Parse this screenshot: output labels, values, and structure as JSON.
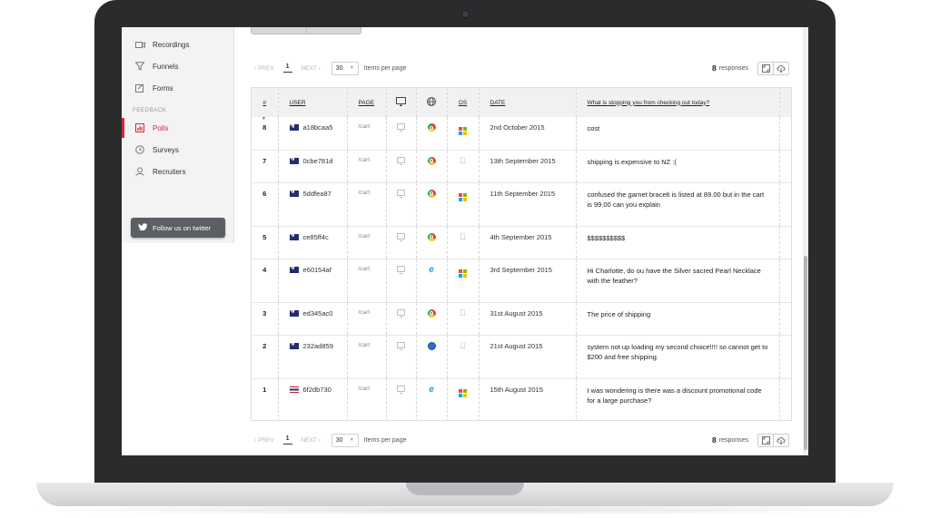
{
  "sidebar": {
    "items": [
      {
        "label": "Recordings",
        "icon": "video-camera-icon",
        "active": false
      },
      {
        "label": "Funnels",
        "icon": "funnel-icon",
        "active": false
      },
      {
        "label": "Forms",
        "icon": "form-icon",
        "active": false
      }
    ],
    "section_heading": "FEEDBACK",
    "feedback_items": [
      {
        "label": "Polls",
        "icon": "bar-chart-icon",
        "active": true
      },
      {
        "label": "Surveys",
        "icon": "clock-icon",
        "active": false
      },
      {
        "label": "Recruiters",
        "icon": "user-icon",
        "active": false
      }
    ],
    "twitter_button": "Follow us on twitter",
    "accent_color": "#d7263d"
  },
  "pager": {
    "prev": "‹ PREV",
    "page": "1",
    "next": "NEXT ›",
    "per_page": "30",
    "per_page_label": "Items per page"
  },
  "responses": {
    "count": "8",
    "label": "responses"
  },
  "table": {
    "headers": {
      "num": "#",
      "user": "USER",
      "page": "PAGE",
      "os": "OS",
      "date": "DATE",
      "question": "What is stopping you from checking out today?"
    },
    "rows": [
      {
        "num": "8",
        "flag": "australia",
        "user": "a18bcaa5",
        "page": "/cart",
        "device": "desktop-icon",
        "browser": "chrome",
        "os": "windows",
        "date": "2nd October 2015",
        "answer": "cost"
      },
      {
        "num": "7",
        "flag": "australia",
        "user": "0cbe781d",
        "page": "/cart",
        "device": "desktop-icon",
        "browser": "chrome",
        "os": "apple",
        "date": "13th September 2015",
        "answer": "shipping is expensive to NZ :("
      },
      {
        "num": "6",
        "flag": "australia",
        "user": "5ddfea87",
        "page": "/cart",
        "device": "desktop-icon",
        "browser": "chrome",
        "os": "windows",
        "date": "11th September 2015",
        "answer": "confused the garnet bracelt is listed at 89.00 but in the cart is 99.00 can you explain"
      },
      {
        "num": "5",
        "flag": "australia",
        "user": "ce85ff4c",
        "page": "/cart",
        "device": "desktop-icon",
        "browser": "chrome",
        "os": "apple",
        "date": "4th September 2015",
        "answer": "$$$$$$$$$$"
      },
      {
        "num": "4",
        "flag": "australia",
        "user": "e60154af",
        "page": "/cart",
        "device": "desktop-icon",
        "browser": "ie",
        "os": "windows",
        "date": "3rd September 2015",
        "answer": "Hi Charlotte, do ou have the Silver sacred Pearl Necklace with the feather?"
      },
      {
        "num": "3",
        "flag": "australia",
        "user": "ed345ac0",
        "page": "/cart",
        "device": "desktop-icon",
        "browser": "chrome",
        "os": "apple",
        "date": "31st August 2015",
        "answer": "The price of shipping"
      },
      {
        "num": "2",
        "flag": "australia",
        "user": "232ad859",
        "page": "/cart",
        "device": "desktop-icon",
        "browser": "ie-old",
        "os": "apple",
        "date": "21st August 2015",
        "answer": "system not up loading my second choice!!!! so cannot get to $200 and free shipping."
      },
      {
        "num": "1",
        "flag": "thailand",
        "user": "6f2db730",
        "page": "/cart",
        "device": "desktop-icon",
        "browser": "ie",
        "os": "windows",
        "date": "15th August 2015",
        "answer": "I was wondering is there was a discount promotional code for a large purchase?"
      }
    ]
  }
}
